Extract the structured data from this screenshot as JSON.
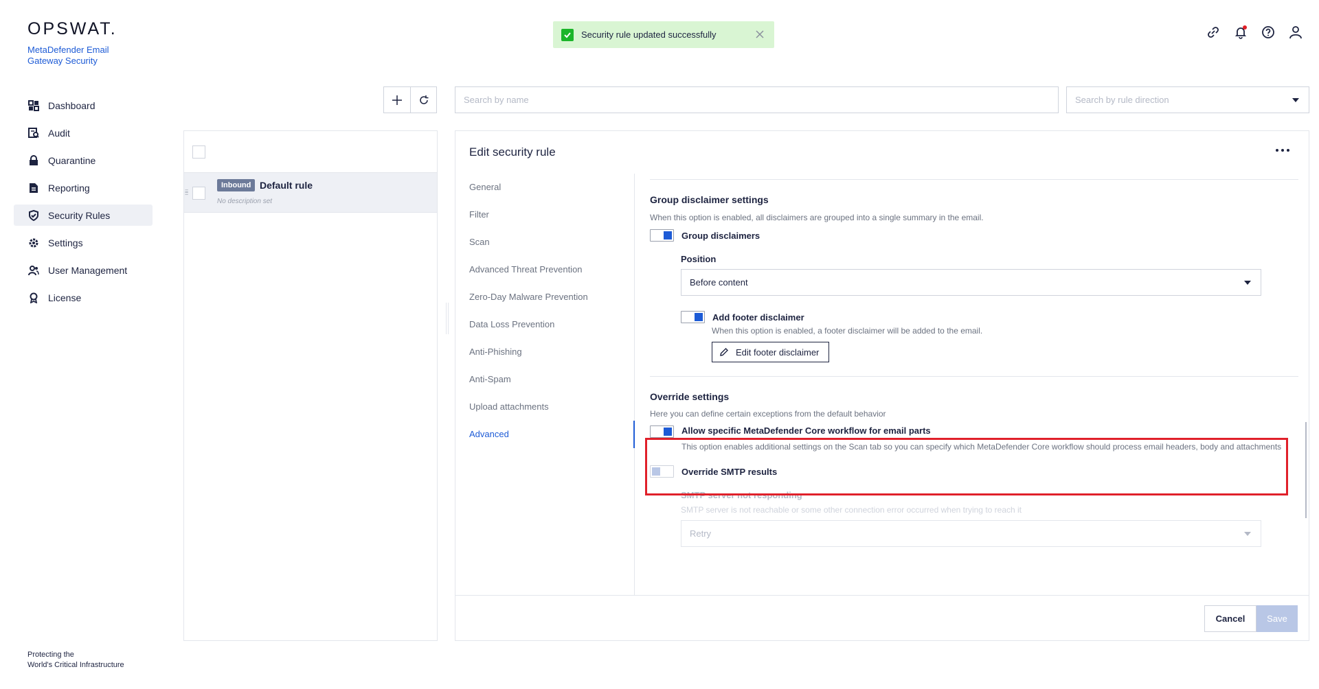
{
  "brand": {
    "logo": "OPSWAT.",
    "product": "MetaDefender Email Gateway Security"
  },
  "sidebar": {
    "items": [
      {
        "label": "Dashboard",
        "icon": "dashboard-icon"
      },
      {
        "label": "Audit",
        "icon": "audit-icon"
      },
      {
        "label": "Quarantine",
        "icon": "lock-icon"
      },
      {
        "label": "Reporting",
        "icon": "report-icon"
      },
      {
        "label": "Security Rules",
        "icon": "shield-check-icon",
        "active": true
      },
      {
        "label": "Settings",
        "icon": "gear-icon"
      },
      {
        "label": "User Management",
        "icon": "users-icon"
      },
      {
        "label": "License",
        "icon": "award-icon"
      }
    ],
    "footer_line1": "Protecting the",
    "footer_line2": "World's Critical Infrastructure"
  },
  "toast": {
    "message": "Security rule updated successfully",
    "color": "#d9f5d3"
  },
  "header_icons": [
    "link-icon",
    "bell-icon",
    "help-icon",
    "user-icon"
  ],
  "toolbar": {
    "search_name_placeholder": "Search by name",
    "search_direction_placeholder": "Search by rule direction"
  },
  "rules": [
    {
      "direction": "Inbound",
      "name": "Default rule",
      "description": "No description set"
    }
  ],
  "editor": {
    "title": "Edit security rule",
    "tabs": [
      {
        "label": "General"
      },
      {
        "label": "Filter"
      },
      {
        "label": "Scan"
      },
      {
        "label": "Advanced Threat Prevention"
      },
      {
        "label": "Zero-Day Malware Prevention"
      },
      {
        "label": "Data Loss Prevention"
      },
      {
        "label": "Anti-Phishing"
      },
      {
        "label": "Anti-Spam"
      },
      {
        "label": "Upload attachments"
      },
      {
        "label": "Advanced",
        "active": true
      }
    ],
    "group_disclaimer": {
      "title": "Group disclaimer settings",
      "description": "When this option is enabled, all disclaimers are grouped into a single summary in the email.",
      "toggle_label": "Group disclaimers",
      "position_label": "Position",
      "position_value": "Before content",
      "footer_toggle_label": "Add footer disclaimer",
      "footer_description": "When this option is enabled, a footer disclaimer will be added to the email.",
      "edit_footer_button": "Edit footer disclaimer"
    },
    "override": {
      "title": "Override settings",
      "description": "Here you can define certain exceptions from the default behavior",
      "workflow_label": "Allow specific MetaDefender Core workflow for email parts",
      "workflow_description": "This option enables additional settings on the Scan tab so you can specify which MetaDefender Core workflow should process email headers, body and attachments",
      "smtp_label": "Override SMTP results",
      "smtp_not_responding_label": "SMTP server not responding",
      "smtp_not_responding_description": "SMTP server is not reachable or some other connection error occurred when trying to reach it",
      "smtp_not_responding_value": "Retry"
    },
    "cancel_label": "Cancel",
    "save_label": "Save"
  },
  "colors": {
    "accent": "#1d5bd6",
    "highlight": "#e0202a",
    "success": "#1bb52a"
  }
}
